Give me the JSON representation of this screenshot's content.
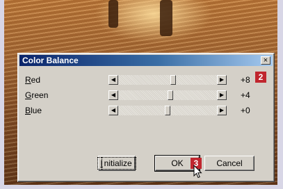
{
  "dialog": {
    "title": "Color Balance",
    "close_label": "×"
  },
  "sliders": [
    {
      "label": "Red",
      "mnemonic": "R",
      "rest": "ed",
      "value": "+8",
      "level": 0.56
    },
    {
      "label": "Green",
      "mnemonic": "G",
      "rest": "reen",
      "value": "+4",
      "level": 0.53
    },
    {
      "label": "Blue",
      "mnemonic": "B",
      "rest": "lue",
      "value": "+0",
      "level": 0.5
    }
  ],
  "buttons": {
    "initialize_mnemonic": "I",
    "initialize_rest": "nitialize",
    "ok": "OK",
    "cancel": "Cancel"
  },
  "badges": {
    "step2": "2",
    "step3": "3"
  },
  "colors": {
    "badge": "#c0262e",
    "title_start": "#0a246a",
    "title_end": "#a6caf0"
  },
  "icons": {
    "scroll_left": "left-arrow-icon",
    "scroll_right": "right-arrow-icon",
    "cursor": "mouse-pointer-icon"
  }
}
